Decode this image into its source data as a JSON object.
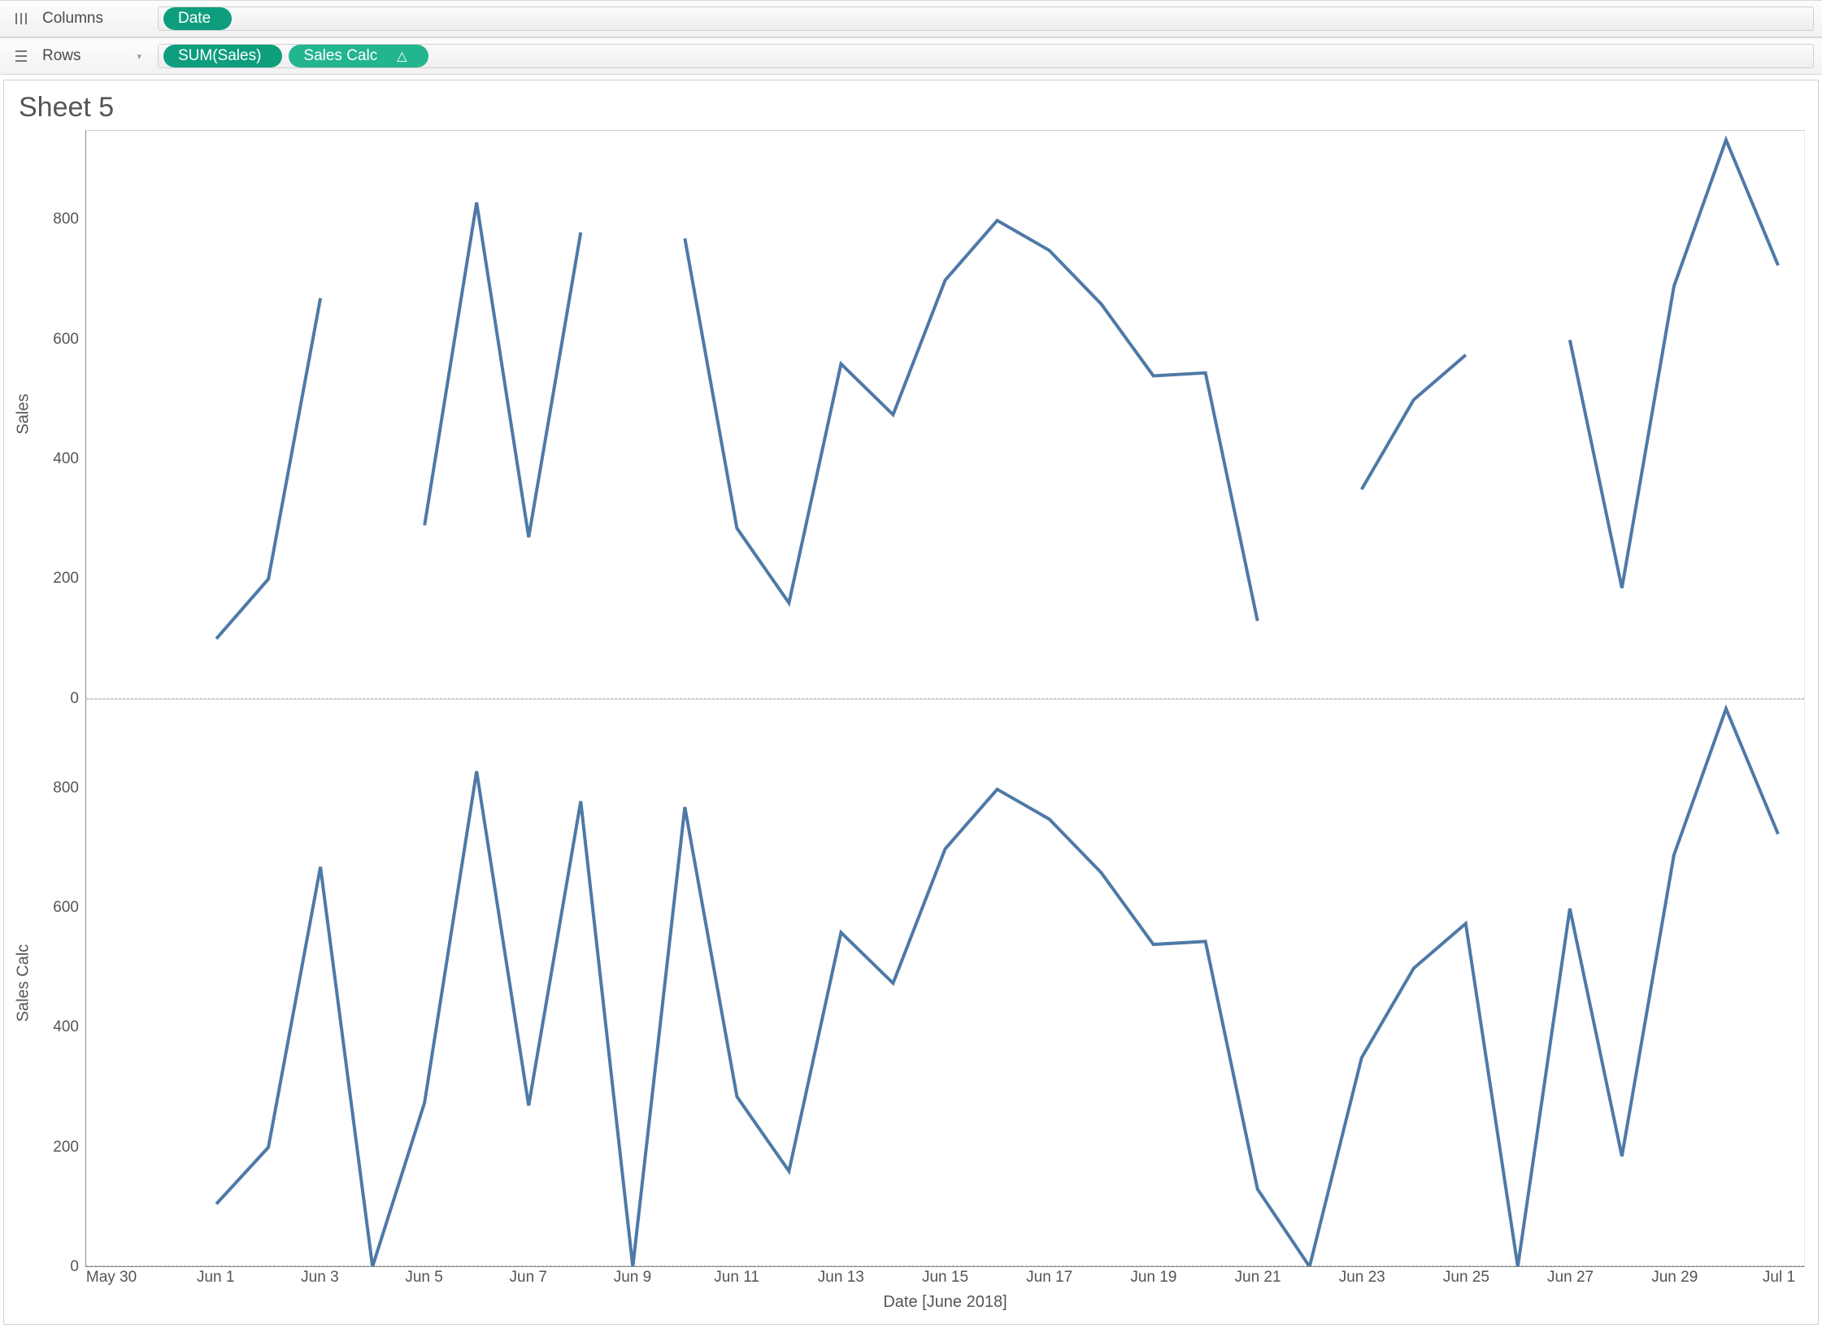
{
  "shelves": {
    "columns_label": "Columns",
    "rows_label": "Rows",
    "columns_pills": [
      {
        "label": "Date"
      }
    ],
    "rows_pills": [
      {
        "label": "SUM(Sales)"
      },
      {
        "label": "Sales Calc",
        "has_delta": true
      }
    ]
  },
  "sheet_title": "Sheet 5",
  "x_axis_label": "Date [June 2018]",
  "y_axes": [
    {
      "title": "Sales",
      "max": 950,
      "ticks": [
        0,
        200,
        400,
        600,
        800
      ]
    },
    {
      "title": "Sales Calc",
      "max": 950,
      "ticks": [
        0,
        200,
        400,
        600,
        800
      ]
    }
  ],
  "x_tick_positions": [
    -1,
    1,
    3,
    5,
    7,
    9,
    11,
    13,
    15,
    17,
    19,
    21,
    23,
    25,
    27,
    29,
    31
  ],
  "x_tick_labels": [
    "May 30",
    "Jun 1",
    "Jun 3",
    "Jun 5",
    "Jun 7",
    "Jun 9",
    "Jun 11",
    "Jun 13",
    "Jun 15",
    "Jun 17",
    "Jun 19",
    "Jun 21",
    "Jun 23",
    "Jun 25",
    "Jun 27",
    "Jun 29",
    "Jul 1"
  ],
  "x_domain": [
    -1.5,
    31.5
  ],
  "colors": {
    "line": "#4E79A7",
    "pill_primary": "#0E9E7D",
    "pill_secondary": "#23B58E"
  },
  "chart_data": [
    {
      "type": "line",
      "title": "",
      "xlabel": "Date [June 2018]",
      "ylabel": "Sales",
      "ylim": [
        0,
        950
      ],
      "series": [
        {
          "name": "Sales",
          "segments": [
            {
              "x": [
                1,
                2,
                3
              ],
              "y": [
                100,
                200,
                670
              ]
            },
            {
              "x": [
                5,
                6,
                7,
                8
              ],
              "y": [
                290,
                830,
                270,
                780
              ]
            },
            {
              "x": [
                10,
                11,
                12,
                13,
                14,
                15,
                16,
                17,
                18,
                19,
                20,
                21
              ],
              "y": [
                770,
                285,
                160,
                560,
                475,
                700,
                800,
                750,
                660,
                540,
                545,
                130
              ]
            },
            {
              "x": [
                23,
                24,
                25
              ],
              "y": [
                350,
                500,
                575
              ]
            },
            {
              "x": [
                27,
                28,
                29,
                30,
                31
              ],
              "y": [
                600,
                185,
                690,
                935,
                725
              ]
            }
          ]
        }
      ]
    },
    {
      "type": "line",
      "title": "",
      "xlabel": "Date [June 2018]",
      "ylabel": "Sales Calc",
      "ylim": [
        0,
        950
      ],
      "series": [
        {
          "name": "Sales Calc",
          "segments": [
            {
              "x": [
                1,
                2,
                3,
                4,
                5,
                6,
                7,
                8,
                9,
                10,
                11,
                12,
                13,
                14,
                15,
                16,
                17,
                18,
                19,
                20,
                21,
                22,
                23,
                24,
                25,
                26,
                27,
                28,
                29,
                30,
                31
              ],
              "y": [
                105,
                200,
                670,
                0,
                275,
                830,
                270,
                780,
                0,
                770,
                285,
                160,
                560,
                475,
                700,
                800,
                750,
                660,
                540,
                545,
                130,
                0,
                350,
                500,
                575,
                0,
                600,
                185,
                690,
                935,
                725
              ]
            }
          ]
        }
      ]
    }
  ]
}
